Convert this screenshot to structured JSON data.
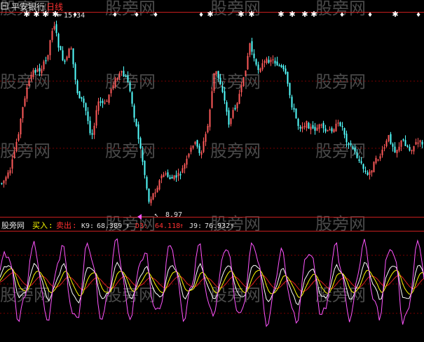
{
  "title": {
    "stock_name": "平安银行",
    "period": "日线"
  },
  "markers": {
    "high_label": "15.34",
    "low_label": "8.97"
  },
  "indicator": {
    "name": "股旁网",
    "buy_label": "买入",
    "sell_label": "卖出",
    "k_label": "K9:",
    "k_value": "68.389",
    "d_label": "D3:",
    "d_value": "64.118",
    "j_label": "J9:",
    "j_value": "76.932"
  },
  "watermark": "股旁网",
  "colors": {
    "background": "#000000",
    "up_candle": "#ff5a5a",
    "down_candle": "#54ffff",
    "separator": "#c81e1e",
    "grid": "#7a0000",
    "k_line": "#ffffff",
    "d_line": "#ffff00",
    "j_line": "#ff55ff",
    "slow_line": "#dd2222",
    "title_text": "#e0e0e0",
    "period_text": "#ff3030",
    "buy_text": "#ffff00",
    "sell_text": "#ff3030",
    "k_text": "#e0e0e0",
    "d_text": "#ff3030",
    "j_text": "#e0e0e0"
  }
}
